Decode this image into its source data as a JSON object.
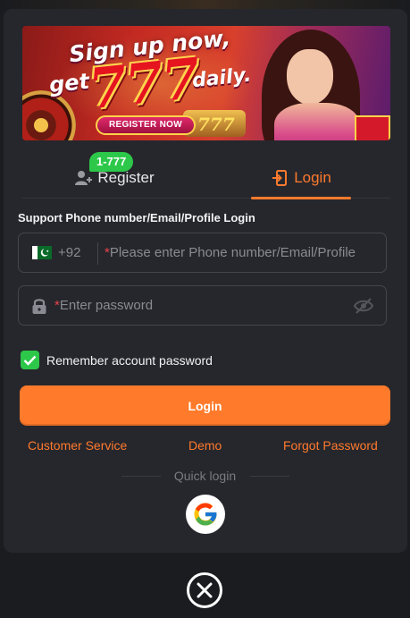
{
  "banner": {
    "title": "Sign up now,",
    "get": "get",
    "number": "777",
    "daily": "daily.",
    "button_label": "REGISTER NOW",
    "slot_text": "777"
  },
  "tabs": {
    "register_label": "Register",
    "register_badge": "1-777",
    "login_label": "Login",
    "active": "login"
  },
  "form": {
    "support_label": "Support Phone number/Email/Profile Login",
    "country_code": "+92",
    "phone_required": "*",
    "phone_placeholder": "Please enter Phone number/Email/Profile",
    "password_required": "*",
    "password_placeholder": "Enter password",
    "remember_label": "Remember account password",
    "remember_checked": true,
    "login_button": "Login"
  },
  "links": {
    "customer_service": "Customer Service",
    "demo": "Demo",
    "forgot_password": "Forgot Password"
  },
  "quick_login": {
    "label": "Quick login",
    "providers": [
      "google-icon"
    ]
  },
  "colors": {
    "accent": "#ff7a2e",
    "success": "#2dc84a",
    "background": "#1b1c20",
    "panel": "#26272c",
    "required": "#e8434a"
  }
}
